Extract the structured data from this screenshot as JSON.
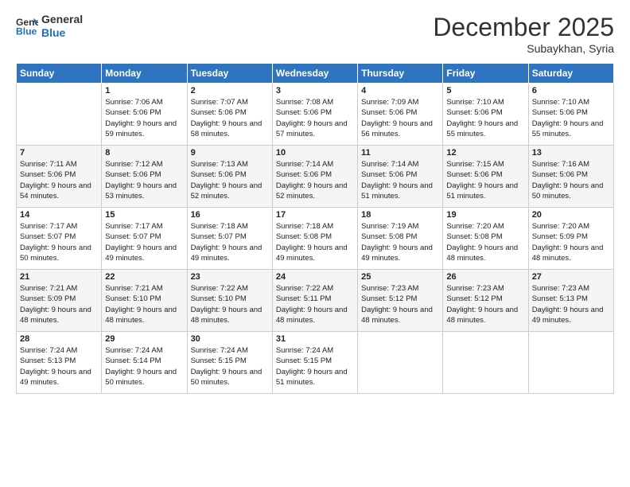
{
  "header": {
    "logo_line1": "General",
    "logo_line2": "Blue",
    "month": "December 2025",
    "location": "Subaykhan, Syria"
  },
  "days_of_week": [
    "Sunday",
    "Monday",
    "Tuesday",
    "Wednesday",
    "Thursday",
    "Friday",
    "Saturday"
  ],
  "weeks": [
    [
      {
        "day": "",
        "sunrise": "",
        "sunset": "",
        "daylight": ""
      },
      {
        "day": "1",
        "sunrise": "Sunrise: 7:06 AM",
        "sunset": "Sunset: 5:06 PM",
        "daylight": "Daylight: 9 hours and 59 minutes."
      },
      {
        "day": "2",
        "sunrise": "Sunrise: 7:07 AM",
        "sunset": "Sunset: 5:06 PM",
        "daylight": "Daylight: 9 hours and 58 minutes."
      },
      {
        "day": "3",
        "sunrise": "Sunrise: 7:08 AM",
        "sunset": "Sunset: 5:06 PM",
        "daylight": "Daylight: 9 hours and 57 minutes."
      },
      {
        "day": "4",
        "sunrise": "Sunrise: 7:09 AM",
        "sunset": "Sunset: 5:06 PM",
        "daylight": "Daylight: 9 hours and 56 minutes."
      },
      {
        "day": "5",
        "sunrise": "Sunrise: 7:10 AM",
        "sunset": "Sunset: 5:06 PM",
        "daylight": "Daylight: 9 hours and 55 minutes."
      },
      {
        "day": "6",
        "sunrise": "Sunrise: 7:10 AM",
        "sunset": "Sunset: 5:06 PM",
        "daylight": "Daylight: 9 hours and 55 minutes."
      }
    ],
    [
      {
        "day": "7",
        "sunrise": "Sunrise: 7:11 AM",
        "sunset": "Sunset: 5:06 PM",
        "daylight": "Daylight: 9 hours and 54 minutes."
      },
      {
        "day": "8",
        "sunrise": "Sunrise: 7:12 AM",
        "sunset": "Sunset: 5:06 PM",
        "daylight": "Daylight: 9 hours and 53 minutes."
      },
      {
        "day": "9",
        "sunrise": "Sunrise: 7:13 AM",
        "sunset": "Sunset: 5:06 PM",
        "daylight": "Daylight: 9 hours and 52 minutes."
      },
      {
        "day": "10",
        "sunrise": "Sunrise: 7:14 AM",
        "sunset": "Sunset: 5:06 PM",
        "daylight": "Daylight: 9 hours and 52 minutes."
      },
      {
        "day": "11",
        "sunrise": "Sunrise: 7:14 AM",
        "sunset": "Sunset: 5:06 PM",
        "daylight": "Daylight: 9 hours and 51 minutes."
      },
      {
        "day": "12",
        "sunrise": "Sunrise: 7:15 AM",
        "sunset": "Sunset: 5:06 PM",
        "daylight": "Daylight: 9 hours and 51 minutes."
      },
      {
        "day": "13",
        "sunrise": "Sunrise: 7:16 AM",
        "sunset": "Sunset: 5:06 PM",
        "daylight": "Daylight: 9 hours and 50 minutes."
      }
    ],
    [
      {
        "day": "14",
        "sunrise": "Sunrise: 7:17 AM",
        "sunset": "Sunset: 5:07 PM",
        "daylight": "Daylight: 9 hours and 50 minutes."
      },
      {
        "day": "15",
        "sunrise": "Sunrise: 7:17 AM",
        "sunset": "Sunset: 5:07 PM",
        "daylight": "Daylight: 9 hours and 49 minutes."
      },
      {
        "day": "16",
        "sunrise": "Sunrise: 7:18 AM",
        "sunset": "Sunset: 5:07 PM",
        "daylight": "Daylight: 9 hours and 49 minutes."
      },
      {
        "day": "17",
        "sunrise": "Sunrise: 7:18 AM",
        "sunset": "Sunset: 5:08 PM",
        "daylight": "Daylight: 9 hours and 49 minutes."
      },
      {
        "day": "18",
        "sunrise": "Sunrise: 7:19 AM",
        "sunset": "Sunset: 5:08 PM",
        "daylight": "Daylight: 9 hours and 49 minutes."
      },
      {
        "day": "19",
        "sunrise": "Sunrise: 7:20 AM",
        "sunset": "Sunset: 5:08 PM",
        "daylight": "Daylight: 9 hours and 48 minutes."
      },
      {
        "day": "20",
        "sunrise": "Sunrise: 7:20 AM",
        "sunset": "Sunset: 5:09 PM",
        "daylight": "Daylight: 9 hours and 48 minutes."
      }
    ],
    [
      {
        "day": "21",
        "sunrise": "Sunrise: 7:21 AM",
        "sunset": "Sunset: 5:09 PM",
        "daylight": "Daylight: 9 hours and 48 minutes."
      },
      {
        "day": "22",
        "sunrise": "Sunrise: 7:21 AM",
        "sunset": "Sunset: 5:10 PM",
        "daylight": "Daylight: 9 hours and 48 minutes."
      },
      {
        "day": "23",
        "sunrise": "Sunrise: 7:22 AM",
        "sunset": "Sunset: 5:10 PM",
        "daylight": "Daylight: 9 hours and 48 minutes."
      },
      {
        "day": "24",
        "sunrise": "Sunrise: 7:22 AM",
        "sunset": "Sunset: 5:11 PM",
        "daylight": "Daylight: 9 hours and 48 minutes."
      },
      {
        "day": "25",
        "sunrise": "Sunrise: 7:23 AM",
        "sunset": "Sunset: 5:12 PM",
        "daylight": "Daylight: 9 hours and 48 minutes."
      },
      {
        "day": "26",
        "sunrise": "Sunrise: 7:23 AM",
        "sunset": "Sunset: 5:12 PM",
        "daylight": "Daylight: 9 hours and 48 minutes."
      },
      {
        "day": "27",
        "sunrise": "Sunrise: 7:23 AM",
        "sunset": "Sunset: 5:13 PM",
        "daylight": "Daylight: 9 hours and 49 minutes."
      }
    ],
    [
      {
        "day": "28",
        "sunrise": "Sunrise: 7:24 AM",
        "sunset": "Sunset: 5:13 PM",
        "daylight": "Daylight: 9 hours and 49 minutes."
      },
      {
        "day": "29",
        "sunrise": "Sunrise: 7:24 AM",
        "sunset": "Sunset: 5:14 PM",
        "daylight": "Daylight: 9 hours and 50 minutes."
      },
      {
        "day": "30",
        "sunrise": "Sunrise: 7:24 AM",
        "sunset": "Sunset: 5:15 PM",
        "daylight": "Daylight: 9 hours and 50 minutes."
      },
      {
        "day": "31",
        "sunrise": "Sunrise: 7:24 AM",
        "sunset": "Sunset: 5:15 PM",
        "daylight": "Daylight: 9 hours and 51 minutes."
      },
      {
        "day": "",
        "sunrise": "",
        "sunset": "",
        "daylight": ""
      },
      {
        "day": "",
        "sunrise": "",
        "sunset": "",
        "daylight": ""
      },
      {
        "day": "",
        "sunrise": "",
        "sunset": "",
        "daylight": ""
      }
    ]
  ]
}
